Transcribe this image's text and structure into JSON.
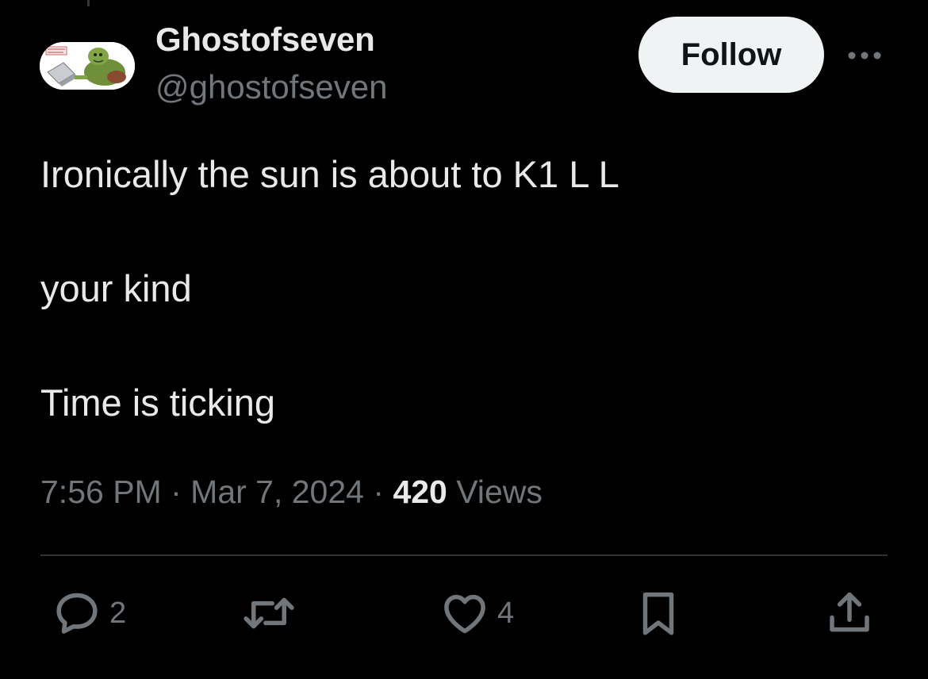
{
  "author": {
    "display_name": "Ghostofseven",
    "handle": "@ghostofseven",
    "avatar_icon": "troll-at-laptop-avatar"
  },
  "follow_label": "Follow",
  "tweet": {
    "lines": [
      "Ironically the sun is about to K1 L L",
      "your kind",
      "Time is ticking"
    ],
    "time": "7:56 PM",
    "separator": "·",
    "date": "Mar 7, 2024",
    "views_count": "420",
    "views_label": "Views"
  },
  "actions": {
    "reply": {
      "icon": "reply-icon",
      "count": "2"
    },
    "retweet": {
      "icon": "retweet-icon",
      "count": ""
    },
    "like": {
      "icon": "heart-icon",
      "count": "4"
    },
    "bookmark": {
      "icon": "bookmark-icon"
    },
    "share": {
      "icon": "share-icon"
    }
  },
  "colors": {
    "background": "#000000",
    "primary_text": "#e7e9ea",
    "secondary_text": "#71767b",
    "follow_bg": "#eff3f4",
    "divider": "#2f3336"
  }
}
